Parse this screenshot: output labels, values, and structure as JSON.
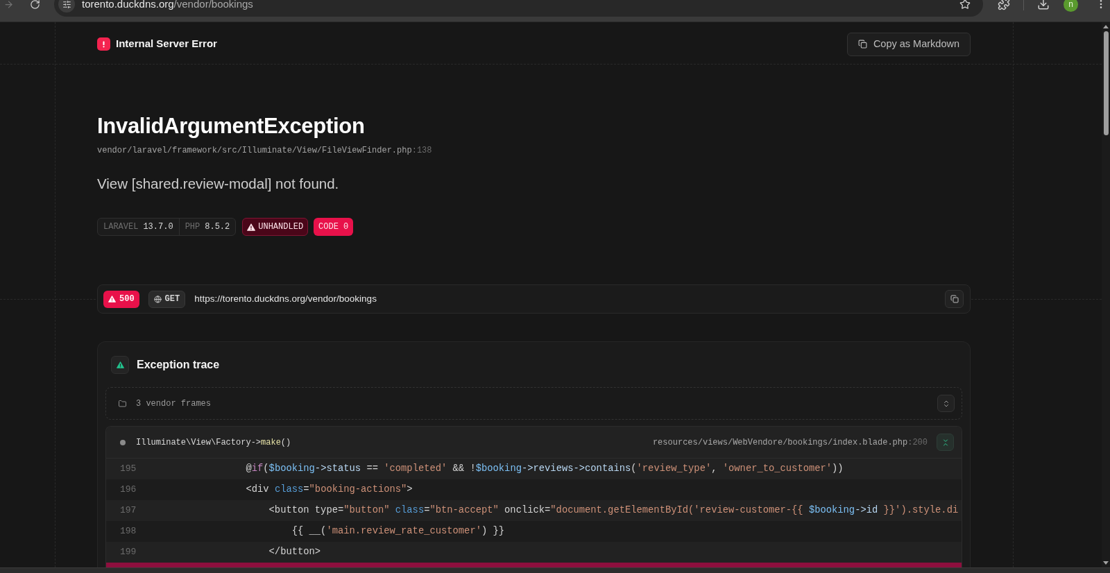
{
  "browser": {
    "url_host": "torento.duckdns.org",
    "url_path": "/vendor/bookings",
    "profile_initial": "n"
  },
  "header": {
    "title": "Internal Server Error",
    "copy_button": "Copy as Markdown"
  },
  "exception": {
    "name": "InvalidArgumentException",
    "file": "vendor/laravel/framework/src/Illuminate/View/FileViewFinder.php",
    "line": ":138",
    "message": "View [shared.review-modal] not found."
  },
  "versions": [
    {
      "label": "LARAVEL",
      "value": "13.7.0"
    },
    {
      "label": "PHP",
      "value": "8.5.2"
    }
  ],
  "flags": [
    {
      "kind": "unhandled",
      "label": "UNHANDLED"
    },
    {
      "kind": "code",
      "label": "CODE 0"
    }
  ],
  "request": {
    "status": "500",
    "method": "GET",
    "url": "https://torento.duckdns.org/vendor/bookings"
  },
  "trace": {
    "title": "Exception trace",
    "vendor_frames": "3 vendor frames",
    "frames": [
      {
        "call": "Illuminate\\View\\Factory->",
        "method": "make",
        "args": "()",
        "file": "resources/views/WebVendore/bookings/index.blade.php",
        "line": ":200",
        "expanded": true,
        "lines": [
          {
            "number": "195",
            "highlighted": false,
            "tokens": [
              {
                "kind": "plain",
                "text": "                @"
              },
              {
                "kind": "keyword",
                "text": "if"
              },
              {
                "kind": "plain",
                "text": "("
              },
              {
                "kind": "variable",
                "text": "$booking"
              },
              {
                "kind": "property",
                "text": "->status"
              },
              {
                "kind": "plain",
                "text": " == "
              },
              {
                "kind": "string",
                "text": "'completed'"
              },
              {
                "kind": "plain",
                "text": " && !"
              },
              {
                "kind": "variable",
                "text": "$booking"
              },
              {
                "kind": "property",
                "text": "->reviews->contains"
              },
              {
                "kind": "plain",
                "text": "("
              },
              {
                "kind": "string",
                "text": "'review_type'"
              },
              {
                "kind": "plain",
                "text": ", "
              },
              {
                "kind": "string",
                "text": "'owner_to_customer'"
              },
              {
                "kind": "plain",
                "text": "))"
              }
            ]
          },
          {
            "number": "196",
            "highlighted": false,
            "tokens": [
              {
                "kind": "plain",
                "text": "                <div "
              },
              {
                "kind": "attr",
                "text": "class"
              },
              {
                "kind": "plain",
                "text": "="
              },
              {
                "kind": "string",
                "text": "\"booking-actions\""
              },
              {
                "kind": "plain",
                "text": ">"
              }
            ]
          },
          {
            "number": "197",
            "highlighted": false,
            "tokens": [
              {
                "kind": "plain",
                "text": "                    <button type="
              },
              {
                "kind": "string",
                "text": "\"button\""
              },
              {
                "kind": "attr",
                "text": " class"
              },
              {
                "kind": "plain",
                "text": "="
              },
              {
                "kind": "string",
                "text": "\"btn-accept\""
              },
              {
                "kind": "plain",
                "text": " onclick="
              },
              {
                "kind": "string",
                "text": "\"document.getElementById('review-customer-{{ "
              },
              {
                "kind": "variable",
                "text": "$booking"
              },
              {
                "kind": "property",
                "text": "->id"
              },
              {
                "kind": "string",
                "text": " }}').style.di"
              }
            ]
          },
          {
            "number": "198",
            "highlighted": false,
            "tokens": [
              {
                "kind": "plain",
                "text": "                        {{ __("
              },
              {
                "kind": "string",
                "text": "'main.review_rate_customer'"
              },
              {
                "kind": "plain",
                "text": ") }}"
              }
            ]
          },
          {
            "number": "199",
            "highlighted": false,
            "tokens": [
              {
                "kind": "plain",
                "text": "                    </button>"
              }
            ]
          },
          {
            "highlighted": true
          }
        ]
      }
    ]
  }
}
